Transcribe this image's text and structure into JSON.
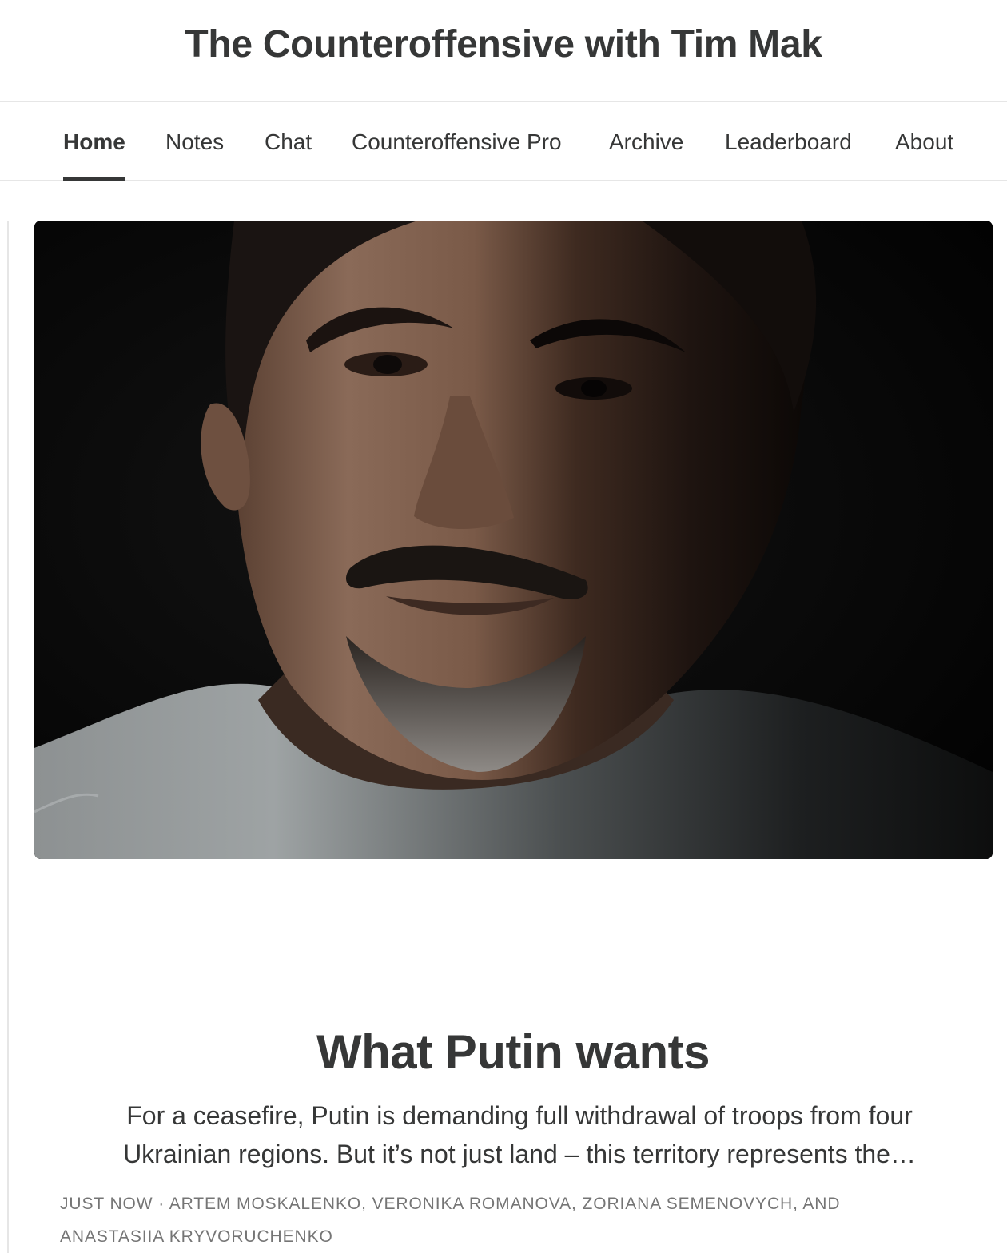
{
  "site": {
    "title": "The Counteroffensive with Tim Mak"
  },
  "nav": {
    "items": [
      {
        "label": "Home",
        "active": true
      },
      {
        "label": "Notes"
      },
      {
        "label": "Chat"
      },
      {
        "label": "Counteroffensive Pro"
      },
      {
        "label": "Archive"
      },
      {
        "label": "Leaderboard"
      },
      {
        "label": "About"
      }
    ]
  },
  "post": {
    "title": "What Putin wants",
    "subtitle": "For a ceasefire, Putin is demanding full withdrawal of troops from four Ukrainian regions. But it’s not just land – this territory represents the…",
    "timestamp": "Just now",
    "separator": " · ",
    "authors": "Artem Moskalenko, Veronika Romanova, Zoriana Semenovych, and Anastasiia Kryvoruchenko"
  },
  "colors": {
    "text": "#363737",
    "muted": "#757575",
    "divider": "#e6e6e6",
    "background": "#ffffff"
  }
}
